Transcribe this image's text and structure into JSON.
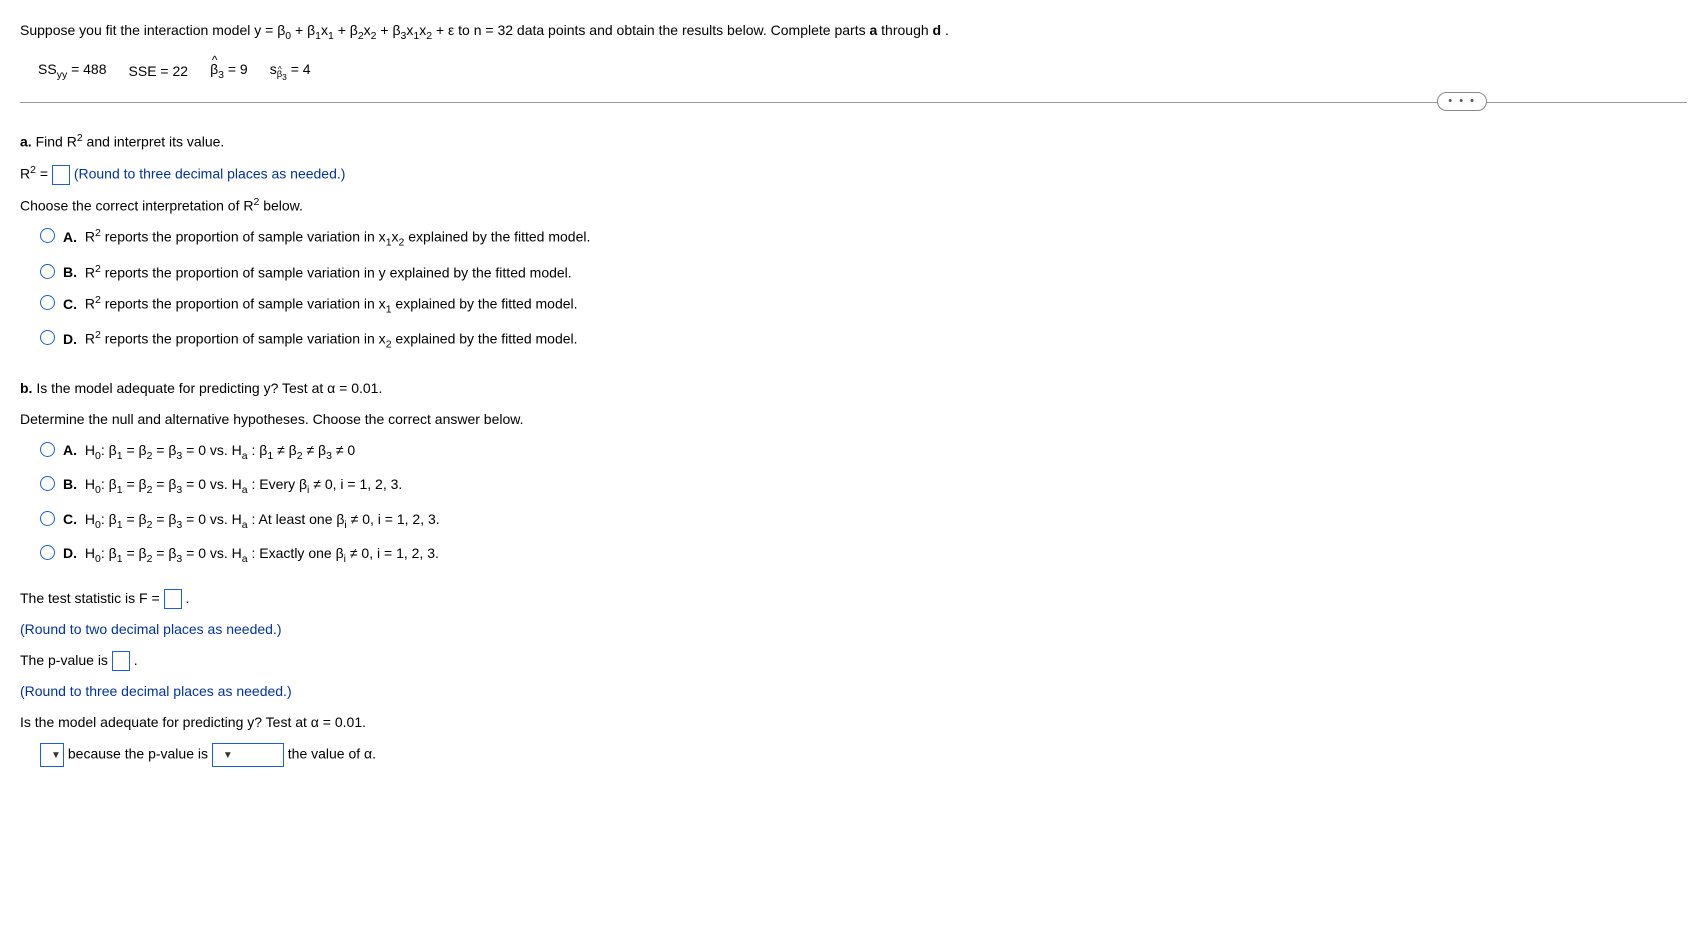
{
  "intro": {
    "prefix": "Suppose you fit the interaction model y = β",
    "model_rest": " + ε to n = 32 data points and obtain the results below. Complete parts ",
    "a": "a",
    "through": " through ",
    "d": "d",
    "period": "."
  },
  "given": {
    "ssyy": "SS",
    "ssyy_sub": "yy",
    "ssyy_val": " = 488",
    "sse": "SSE = 22",
    "beta3_hat_val": " = 9",
    "sbeta3_val": " = 4"
  },
  "ellipsis": "• • •",
  "partA": {
    "title_prefix": "a.",
    "title_rest": " Find R",
    "title_after": " and interpret its value.",
    "r2_eq": "R",
    "equals": " = ",
    "round_note": "(Round to three decimal places as needed.)",
    "interp_label_pre": "Choose the correct interpretation of R",
    "interp_label_post": " below.",
    "options": {
      "A": {
        "letter": "A.",
        "pre": "R",
        "post": " reports the proportion of sample variation in x",
        "var": "1",
        "post2": "x",
        "var2": "2",
        "tail": " explained by the fitted model."
      },
      "B": {
        "letter": "B.",
        "pre": "R",
        "post": " reports the proportion of sample variation in y explained by the fitted model."
      },
      "C": {
        "letter": "C.",
        "pre": "R",
        "post": " reports the proportion of sample variation in x",
        "var": "1",
        "tail": " explained by the fitted model."
      },
      "D": {
        "letter": "D.",
        "pre": "R",
        "post": " reports the proportion of sample variation in x",
        "var": "2",
        "tail": " explained by the fitted model."
      }
    }
  },
  "partB": {
    "title": "b.",
    "title_rest": " Is the model adequate for predicting y? Test at α = 0.01.",
    "hyp_label": "Determine the null and alternative hypotheses. Choose the correct answer below.",
    "options": {
      "A": {
        "letter": "A.",
        "text_pre": "H",
        "h0_sub": "0",
        "h0": ": β",
        "mid": " vs. H",
        "ha_sub": "a",
        "ha": ": β",
        "full": " ≠ β",
        "full2": " ≠ β",
        "full3": " ≠ 0"
      },
      "B": {
        "letter": "B.",
        "tail": ": Every β",
        "tail2": " ≠ 0, i = 1, 2, 3."
      },
      "C": {
        "letter": "C.",
        "tail": ": At least one β",
        "tail2": " ≠ 0, i = 1, 2, 3."
      },
      "D": {
        "letter": "D.",
        "tail": ": Exactly one β",
        "tail2": " ≠ 0, i = 1, 2, 3."
      }
    },
    "common_h0": " = β",
    "common_h0_2": " = β",
    "common_h0_3": " = 0 vs. H",
    "f_label": "The test statistic is F = ",
    "f_period": ".",
    "f_round": "(Round to two decimal places as needed.)",
    "p_label": "The p-value is ",
    "p_period": ".",
    "p_round": "(Round to three decimal places as needed.)",
    "adequate_q": "Is the model adequate for predicting y? Test at α = 0.01.",
    "because": " because the p-value is ",
    "value_of_alpha": " the value of α."
  }
}
